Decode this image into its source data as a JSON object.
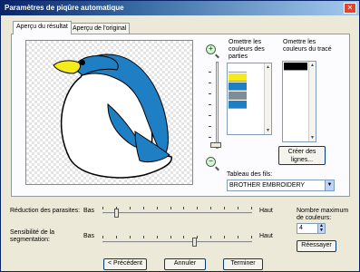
{
  "window": {
    "title": "Paramètres de piqûre automatique"
  },
  "tabs": [
    {
      "label": "Aperçu du résultat",
      "active": true
    },
    {
      "label": "Aperçu de l'original",
      "active": false
    }
  ],
  "colors_panel": {
    "omit_parts_label": "Omettre les couleurs des parties",
    "omit_trace_label": "Omettre les couleurs du tracé",
    "part_swatches": [
      "#ffffff",
      "#f5ea1c",
      "#1f7fc4",
      "#7d8c96",
      "#1f7fc4"
    ],
    "trace_swatches": [
      "#000000"
    ],
    "create_lines_button": "Créer des lignes...",
    "thread_table_label": "Tableau des fils:",
    "thread_table_value": "BROTHER EMBROIDERY"
  },
  "noise_reduction": {
    "label": "Réduction des parasites:",
    "low": "Bas",
    "high": "Haut",
    "level": 0.08
  },
  "segmentation": {
    "label": "Sensibilité de la segmentation:",
    "low": "Bas",
    "high": "Haut",
    "level": 0.62
  },
  "max_colors": {
    "label": "Nombre maximum de couleurs:",
    "value": "4"
  },
  "buttons": {
    "retry": "Réessayer",
    "previous": "< Précédent",
    "cancel": "Annuler",
    "finish": "Terminer"
  },
  "icons": {
    "zoom_in": "zoom-in-icon",
    "zoom_out": "zoom-out-icon",
    "close": "close-icon"
  }
}
